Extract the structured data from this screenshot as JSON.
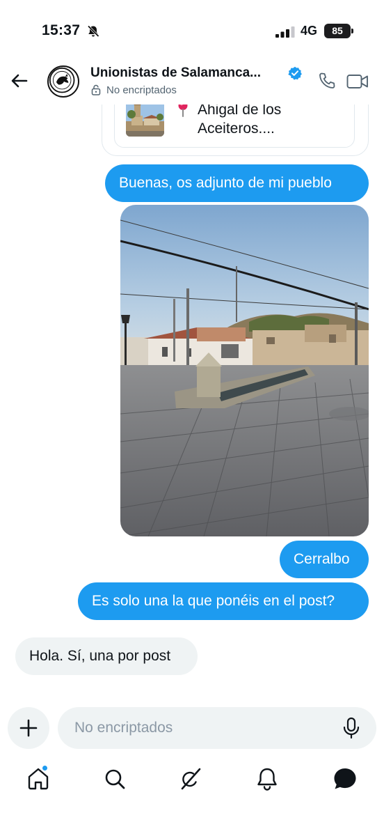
{
  "status_bar": {
    "time": "15:37",
    "network": "4G",
    "battery": "85"
  },
  "header": {
    "title": "Unionistas de Salamanca...",
    "subtitle": "No encriptados"
  },
  "messages": {
    "link_card": {
      "text": "Ahigal de los Aceiteros...."
    },
    "sent_1": "Buenas, os adjunto de mi pueblo",
    "sent_2": "Cerralbo",
    "sent_3": "Es solo una la que ponéis en el post?",
    "received_1": "Hola. Sí, una por post"
  },
  "composer": {
    "placeholder": "No encriptados"
  },
  "colors": {
    "accent": "#1d9bf0",
    "received_bubble": "#eff3f4",
    "text": "#0f1419",
    "secondary_text": "#536471"
  },
  "icons": {
    "back": "arrow-left-icon",
    "verified": "verified-badge-icon",
    "lock": "lock-icon",
    "phone": "phone-icon",
    "video": "video-icon",
    "pin": "map-pin-icon",
    "add": "plus-icon",
    "mic": "microphone-icon",
    "nav": [
      "home-icon",
      "search-icon",
      "grok-icon",
      "bell-icon",
      "messages-icon"
    ]
  }
}
